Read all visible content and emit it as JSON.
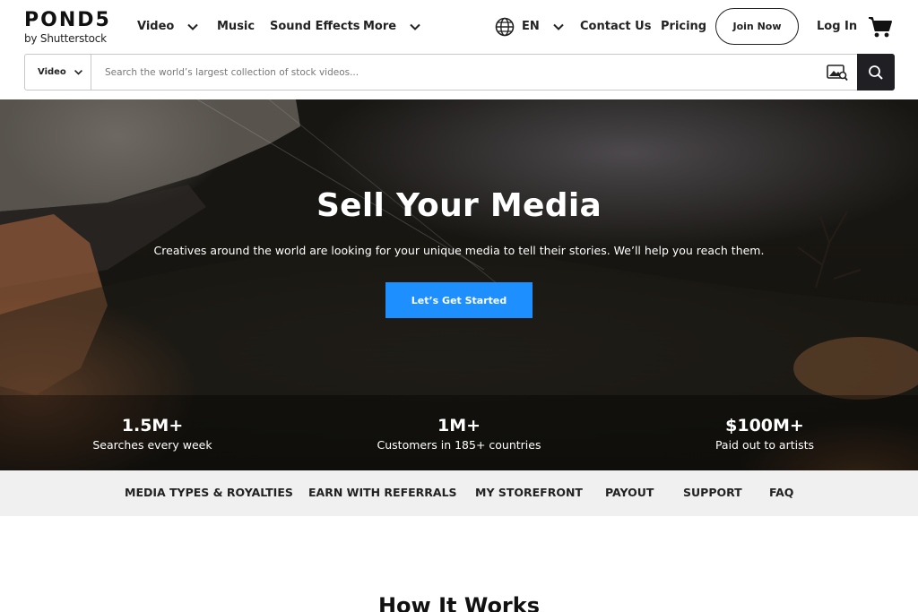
{
  "header": {
    "logo_text": "POND5",
    "logo_subtext": "by Shutterstock",
    "nav": {
      "video": "Video",
      "music": "Music",
      "sound_effects": "Sound Effects",
      "more": "More"
    },
    "language": "EN",
    "contact": "Contact Us",
    "pricing": "Pricing",
    "join": "Join Now",
    "login": "Log In",
    "cart_icon": "cart-icon",
    "globe_icon": "globe-icon"
  },
  "search": {
    "type": "Video",
    "placeholder": "Search the world’s largest collection of stock videos...",
    "value": "",
    "visual_search_icon": "image-search-icon",
    "search_icon": "search-icon"
  },
  "hero": {
    "title": "Sell Your Media",
    "subtitle": "Creatives around the world are looking for your unique media to tell their stories. We’ll help you reach them.",
    "cta": "Let’s Get Started",
    "cta_color": "#1e8fff",
    "stats": [
      {
        "value": "1.5M+",
        "label": "Searches every week"
      },
      {
        "value": "1M+",
        "label": "Customers in 185+ countries"
      },
      {
        "value": "$100M+",
        "label": "Paid out to artists"
      }
    ]
  },
  "subnav": {
    "items": [
      "MEDIA TYPES & ROYALTIES",
      "EARN WITH REFERRALS",
      "MY STOREFRONT",
      "PAYOUT",
      "SUPPORT",
      "FAQ"
    ]
  },
  "section": {
    "title": "How It Works"
  }
}
